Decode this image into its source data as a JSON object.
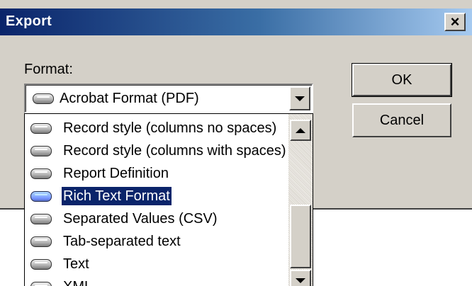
{
  "window": {
    "title": "Export",
    "close_glyph": "×"
  },
  "format": {
    "label": "Format:",
    "selected_value": "Acrobat Format (PDF)"
  },
  "dropdown": {
    "items": [
      {
        "label": "Record style (columns no spaces)",
        "selected": false
      },
      {
        "label": "Record style (columns with spaces)",
        "selected": false
      },
      {
        "label": "Report Definition",
        "selected": false
      },
      {
        "label": "Rich Text Format",
        "selected": true
      },
      {
        "label": "Separated Values (CSV)",
        "selected": false
      },
      {
        "label": "Tab-separated text",
        "selected": false
      },
      {
        "label": "Text",
        "selected": false
      },
      {
        "label": "XML",
        "selected": false
      }
    ]
  },
  "buttons": {
    "ok": "OK",
    "cancel": "Cancel"
  },
  "colors": {
    "dialog_face": "#d4d0c8",
    "titlebar_start": "#0a246a",
    "titlebar_end": "#a6caf0",
    "selection": "#0a246a"
  },
  "icons": {
    "item_icon": "format-file-icon",
    "combo_arrow": "chevron-down-icon"
  }
}
